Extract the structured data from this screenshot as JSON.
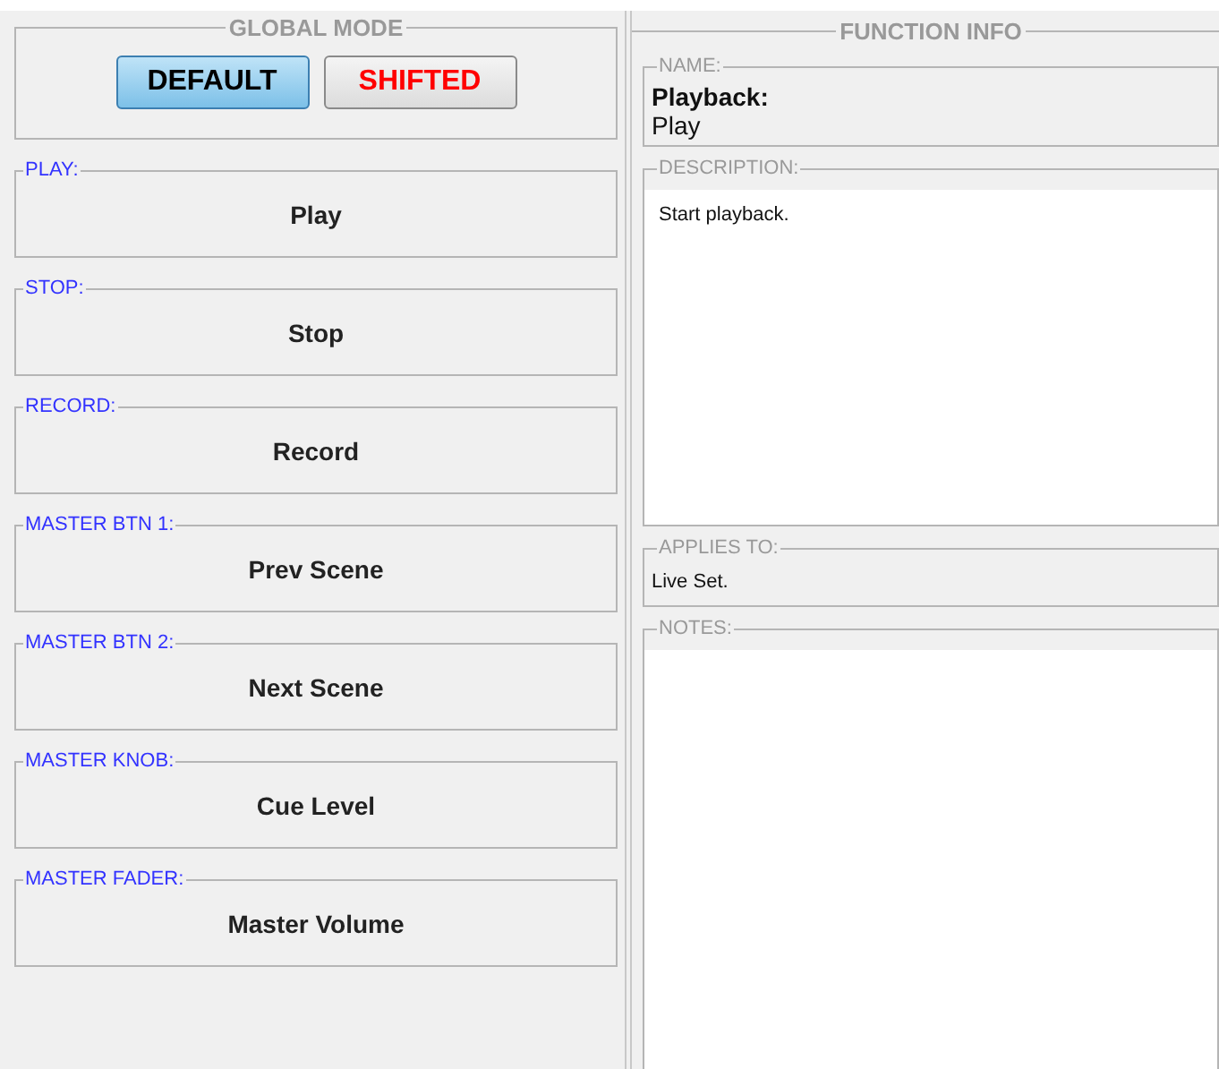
{
  "global_mode": {
    "title": "GLOBAL MODE",
    "buttons": [
      {
        "label": "DEFAULT",
        "selected": true,
        "kind": "normal"
      },
      {
        "label": "SHIFTED",
        "selected": false,
        "kind": "shift"
      }
    ]
  },
  "functions": [
    {
      "label": "PLAY:",
      "value": "Play"
    },
    {
      "label": "STOP:",
      "value": "Stop"
    },
    {
      "label": "RECORD:",
      "value": "Record"
    },
    {
      "label": "MASTER BTN 1:",
      "value": "Prev Scene"
    },
    {
      "label": "MASTER BTN 2:",
      "value": "Next Scene"
    },
    {
      "label": "MASTER KNOB:",
      "value": "Cue Level"
    },
    {
      "label": "MASTER FADER:",
      "value": "Master Volume"
    }
  ],
  "function_info": {
    "title": "FUNCTION INFO",
    "name": {
      "label": "NAME:",
      "category": "Playback:",
      "value": "Play"
    },
    "description": {
      "label": "DESCRIPTION:",
      "text": "Start playback."
    },
    "applies_to": {
      "label": "APPLIES TO:",
      "value": "Live Set."
    },
    "notes": {
      "label": "NOTES:"
    }
  }
}
